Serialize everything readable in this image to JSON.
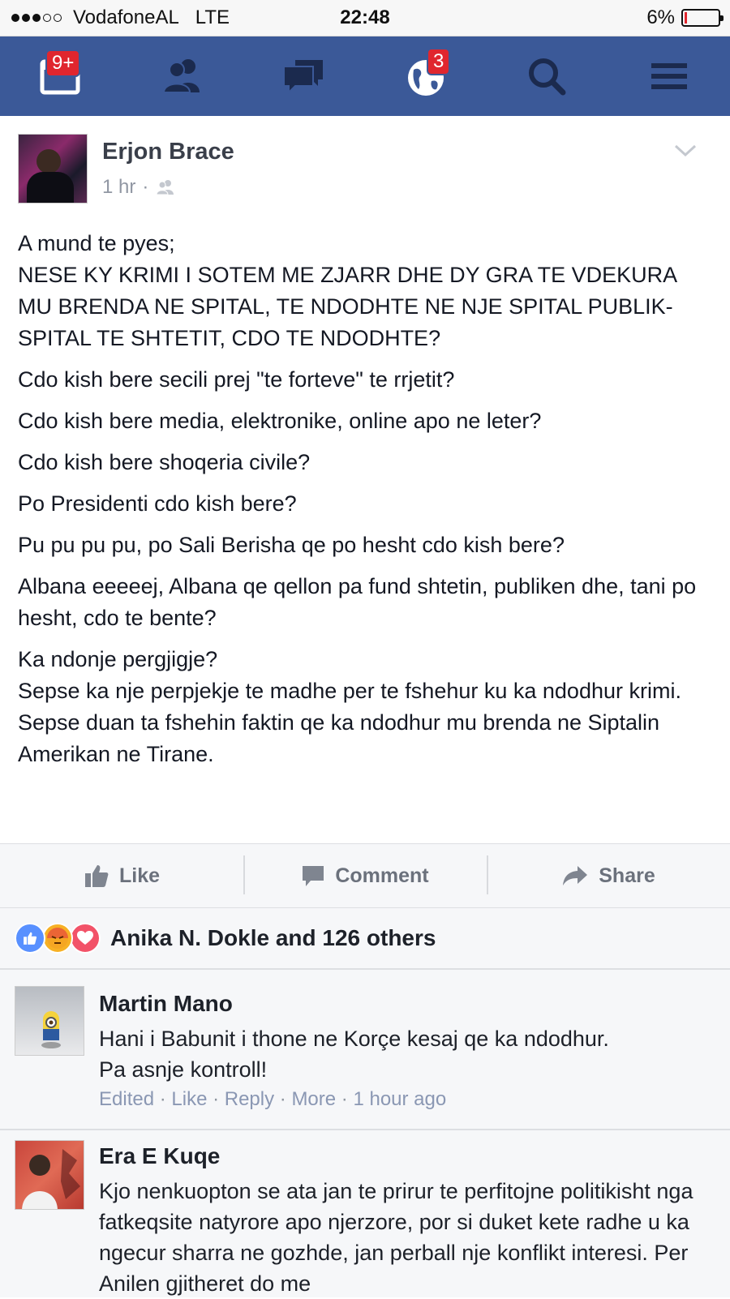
{
  "status_bar": {
    "carrier": "VodafoneAL",
    "network": "LTE",
    "time": "22:48",
    "battery": "6%",
    "battery_level": 0.06,
    "signal_bars": 3,
    "signal_max": 5
  },
  "navbar": {
    "background": "#3b5998",
    "items": [
      {
        "icon": "news-feed-icon",
        "badge": "9+"
      },
      {
        "icon": "friends-icon",
        "badge": ""
      },
      {
        "icon": "messages-icon",
        "badge": ""
      },
      {
        "icon": "notifications-globe-icon",
        "badge": "3"
      },
      {
        "icon": "search-icon",
        "badge": ""
      },
      {
        "icon": "menu-icon",
        "badge": ""
      }
    ]
  },
  "post": {
    "author": "Erjon Brace",
    "time": "1 hr",
    "privacy_icon": "friends-icon",
    "paragraphs": [
      "A mund te pyes;\nNESE KY KRIMI I SOTEM ME ZJARR DHE DY GRA TE VDEKURA MU BRENDA NE SPITAL, TE NDODHTE NE NJE SPITAL PUBLIK-SPITAL TE SHTETIT, CDO TE NDODHTE?",
      "Cdo kish bere secili prej \"te forteve\" te rrjetit?",
      "Cdo kish bere media, elektronike, online apo ne leter?",
      "Cdo kish bere shoqeria civile?",
      "Po Presidenti cdo kish bere?",
      "Pu pu pu pu, po Sali Berisha qe po hesht cdo kish bere?",
      "Albana eeeeej, Albana qe qellon pa fund shtetin, publiken dhe, tani po hesht, cdo te bente?",
      "Ka ndonje pergjigje?\nSepse ka nje perpjekje te madhe per te fshehur ku ka ndodhur krimi.\nSepse duan ta fshehin faktin qe ka ndodhur mu brenda ne Siptalin Amerikan ne Tirane."
    ]
  },
  "actions": {
    "like": "Like",
    "comment": "Comment",
    "share": "Share"
  },
  "reactions": {
    "summary": "Anika N. Dokle and 126 others",
    "icons": [
      "like-reaction-icon",
      "angry-reaction-icon",
      "love-reaction-icon"
    ]
  },
  "comments": [
    {
      "author": "Martin Mano",
      "text": "Hani i Babunit i thone ne Korçe kesaj qe ka ndodhur.\nPa asnje kontroll!",
      "meta": {
        "edited": "Edited",
        "like": "Like",
        "reply": "Reply",
        "more": "More",
        "time": "1 hour ago"
      }
    },
    {
      "author": "Era E Kuqe",
      "text": "Kjo nenkuopton se ata jan te prirur te perfitojne politikisht nga fatkeqsite natyrore apo njerzore, por si duket kete radhe u ka ngecur sharra ne gozhde, jan perball nje konflikt interesi. Per Anilen gjitheret do me"
    }
  ]
}
